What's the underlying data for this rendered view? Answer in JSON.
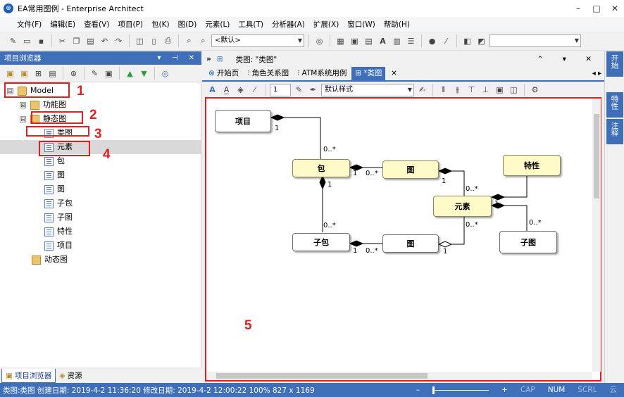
{
  "window": {
    "title": "EA常用图例 - Enterprise Architect",
    "controls": [
      "–",
      "□",
      "✕"
    ]
  },
  "menu": [
    "文件(F)",
    "编辑(E)",
    "查看(V)",
    "项目(P)",
    "包(K)",
    "图(D)",
    "元素(L)",
    "工具(T)",
    "分析器(A)",
    "扩展(X)",
    "窗口(W)",
    "帮助(H)"
  ],
  "toolbar": {
    "style_combo": "<默认>"
  },
  "browser": {
    "title": "项目浏览器",
    "header_controls": "▾ ⊣ ✕",
    "tree": [
      {
        "label": "Model",
        "icon": "model-icon",
        "expander": "⊟"
      },
      {
        "label": "功能图",
        "icon": "diagram-package-icon",
        "expander": "⊞"
      },
      {
        "label": "静态图",
        "icon": "diagram-package-icon",
        "expander": "⊟"
      },
      {
        "label": "类图",
        "icon": "class-diagram-icon"
      },
      {
        "label": "元素",
        "icon": "class-icon"
      },
      {
        "label": "包",
        "icon": "class-icon"
      },
      {
        "label": "图",
        "icon": "class-icon"
      },
      {
        "label": "图",
        "icon": "class-icon"
      },
      {
        "label": "子包",
        "icon": "class-icon"
      },
      {
        "label": "子图",
        "icon": "class-icon"
      },
      {
        "label": "特性",
        "icon": "class-icon"
      },
      {
        "label": "项目",
        "icon": "class-icon"
      },
      {
        "label": "动态图",
        "icon": "diagram-package-icon"
      }
    ],
    "tabs": [
      "项目浏览器",
      "资源"
    ]
  },
  "annotations": [
    "1",
    "2",
    "3",
    "4",
    "5"
  ],
  "document": {
    "header_title": "类图: \"类图\"",
    "header_controls": "⌃ ▾ ✕",
    "tabs": [
      {
        "label": "开始页"
      },
      {
        "label": "角色关系图"
      },
      {
        "label": "ATM系统用例"
      },
      {
        "label": "*类图",
        "active": true
      }
    ],
    "tab_close": "✕",
    "tab_nav": "◂ ▸",
    "zoom_value": "1",
    "style_combo": "默认样式"
  },
  "diagram": {
    "classes": {
      "xiangmu": "项目",
      "bao": "包",
      "tu1": "图",
      "texing": "特性",
      "yuansu": "元素",
      "zibao": "子包",
      "tu2": "图",
      "zitu": "子图"
    },
    "multiplicities": {
      "m1": "1",
      "m2": "0..*",
      "m3": "1",
      "m4": "0..*",
      "m5": "1",
      "m6": "1",
      "m7": "0..*",
      "m8": "0..*",
      "m9": "1",
      "m10": "0..*",
      "m11": "1",
      "m12": "0..*",
      "m13": "0..*",
      "m14": "1"
    }
  },
  "right_tabs": [
    "开始",
    "特性",
    "注释"
  ],
  "status": {
    "text": "类图:类图   创建日期: 2019-4-2 11:36:20  修改日期: 2019-4-2 12:00:22  100%  827 x 1169",
    "zoom_minus": "–",
    "zoom_plus": "+",
    "indicators": [
      "CAP",
      "NUM",
      "SCRL",
      "云"
    ]
  }
}
